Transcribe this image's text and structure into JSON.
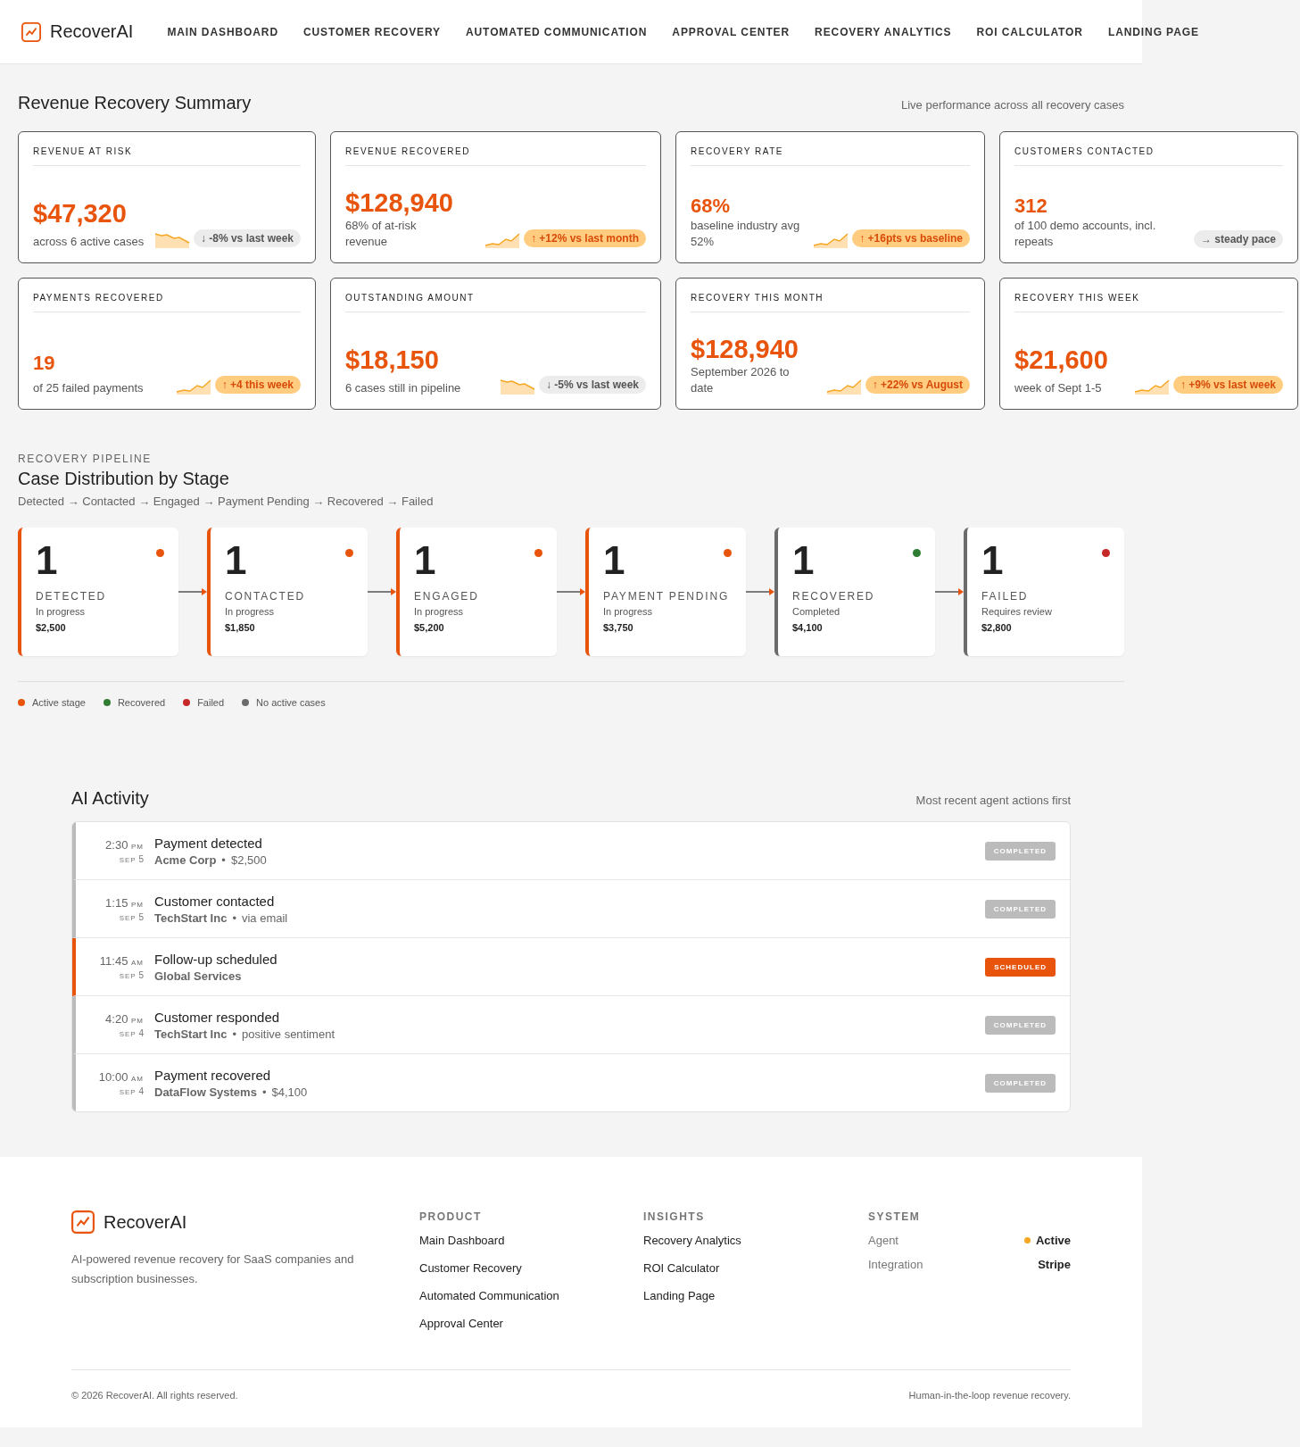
{
  "brand": "RecoverAI",
  "nav": [
    {
      "label": "MAIN DASHBOARD",
      "selected": false
    },
    {
      "label": "CUSTOMER RECOVERY",
      "selected": false
    },
    {
      "label": "AUTOMATED COMMUNICATION",
      "selected": false
    },
    {
      "label": "APPROVAL CENTER",
      "selected": false
    },
    {
      "label": "RECOVERY ANALYTICS",
      "selected": false
    },
    {
      "label": "ROI CALCULATOR",
      "selected": false
    },
    {
      "label": "LANDING PAGE",
      "selected": false
    }
  ],
  "summary": {
    "title": "Revenue Recovery Summary",
    "subtitle": "Live performance across all recovery cases",
    "metrics": [
      {
        "label": "REVENUE AT RISK",
        "value": "$47,320",
        "large": true,
        "note": "across 6 active cases",
        "kind": "falling",
        "change": "↓ -8% vs last week"
      },
      {
        "label": "REVENUE RECOVERED",
        "value": "$128,940",
        "large": true,
        "note": "68% of at-risk revenue",
        "kind": "rising",
        "change": "↑ +12% vs last month"
      },
      {
        "label": "RECOVERY RATE",
        "value": "68%",
        "large": false,
        "note": "baseline industry avg 52%",
        "kind": "rising",
        "change": "↑ +16pts vs baseline"
      },
      {
        "label": "CUSTOMERS CONTACTED",
        "value": "312",
        "large": false,
        "note": "of 100 demo accounts, incl. repeats",
        "kind": "steady",
        "change": "→ steady pace"
      },
      {
        "label": "PAYMENTS RECOVERED",
        "value": "19",
        "large": false,
        "note": "of 25 failed payments",
        "kind": "rising",
        "change": "↑ +4 this week"
      },
      {
        "label": "OUTSTANDING AMOUNT",
        "value": "$18,150",
        "large": true,
        "note": "6 cases still in pipeline",
        "kind": "falling",
        "change": "↓ -5% vs last week"
      },
      {
        "label": "RECOVERY THIS MONTH",
        "value": "$128,940",
        "large": true,
        "note": "September 2026 to date",
        "kind": "rising",
        "change": "↑ +22% vs August"
      },
      {
        "label": "RECOVERY THIS WEEK",
        "value": "$21,600",
        "large": true,
        "note": "week of Sept 1-5",
        "kind": "rising",
        "change": "↑ +9% vs last week"
      }
    ]
  },
  "pipeline": {
    "eyebrow": "RECOVERY PIPELINE",
    "title": "Case Distribution by Stage",
    "flow": "Detected → Contacted → Engaged → Payment Pending → Recovered → Failed",
    "stages": [
      {
        "count": "1",
        "name": "DETECTED",
        "status_text": "In progress",
        "amount": "$2,500",
        "active": true,
        "color": "#e8540c"
      },
      {
        "count": "1",
        "name": "CONTACTED",
        "status_text": "In progress",
        "amount": "$1,850",
        "active": true,
        "color": "#e8540c"
      },
      {
        "count": "1",
        "name": "ENGAGED",
        "status_text": "In progress",
        "amount": "$5,200",
        "active": true,
        "color": "#e8540c"
      },
      {
        "count": "1",
        "name": "PAYMENT PENDING",
        "status_text": "In progress",
        "amount": "$3,750",
        "active": true,
        "color": "#e8540c"
      },
      {
        "count": "1",
        "name": "RECOVERED",
        "status_text": "Completed",
        "amount": "$4,100",
        "active": false,
        "color": "#2e7d32"
      },
      {
        "count": "1",
        "name": "FAILED",
        "status_text": "Requires review",
        "amount": "$2,800",
        "active": false,
        "color": "#c62828"
      }
    ],
    "legend": [
      {
        "label": "Active stage",
        "color": "#e8540c"
      },
      {
        "label": "Recovered",
        "color": "#2e7d32"
      },
      {
        "label": "Failed",
        "color": "#c62828"
      },
      {
        "label": "No active cases",
        "color": "#6b6b6b"
      }
    ]
  },
  "activity": {
    "title": "AI Activity",
    "subtitle": "Most recent agent actions first",
    "items": [
      {
        "time": "2:30",
        "meridiem": "PM",
        "month": "SEP",
        "day": "5",
        "title": "Payment detected",
        "company": "Acme Corp",
        "separator": "•",
        "detail": "$2,500",
        "highlighted": false,
        "status_label": "COMPLETED"
      },
      {
        "time": "1:15",
        "meridiem": "PM",
        "month": "SEP",
        "day": "5",
        "title": "Customer contacted",
        "company": "TechStart Inc",
        "separator": "•",
        "detail": "via email",
        "highlighted": false,
        "status_label": "COMPLETED"
      },
      {
        "time": "11:45",
        "meridiem": "AM",
        "month": "SEP",
        "day": "5",
        "title": "Follow-up scheduled",
        "company": "Global Services",
        "highlighted": true,
        "status_label": "SCHEDULED"
      },
      {
        "time": "4:20",
        "meridiem": "PM",
        "month": "SEP",
        "day": "4",
        "title": "Customer responded",
        "company": "TechStart Inc",
        "separator": "•",
        "detail": "positive sentiment",
        "highlighted": false,
        "status_label": "COMPLETED"
      },
      {
        "time": "10:00",
        "meridiem": "AM",
        "month": "SEP",
        "day": "4",
        "title": "Payment recovered",
        "company": "DataFlow Systems",
        "separator": "•",
        "detail": "$4,100",
        "highlighted": false,
        "status_label": "COMPLETED"
      }
    ]
  },
  "footer": {
    "brand": "RecoverAI",
    "tagline": "AI-powered revenue recovery for SaaS companies and subscription businesses.",
    "columns": [
      {
        "heading": "PRODUCT",
        "links": [
          "Main Dashboard",
          "Customer Recovery",
          "Automated Communication",
          "Approval Center"
        ]
      },
      {
        "heading": "INSIGHTS",
        "links": [
          "Recovery Analytics",
          "ROI Calculator",
          "Landing Page"
        ]
      }
    ],
    "system": {
      "heading": "SYSTEM",
      "rows": [
        {
          "label": "Agent",
          "value": "Active",
          "indicator": true
        },
        {
          "label": "Integration",
          "value": "Stripe",
          "indicator": false
        }
      ]
    },
    "copyright": "© 2026 RecoverAI. All rights reserved.",
    "motto": "Human-in-the-loop revenue recovery."
  }
}
